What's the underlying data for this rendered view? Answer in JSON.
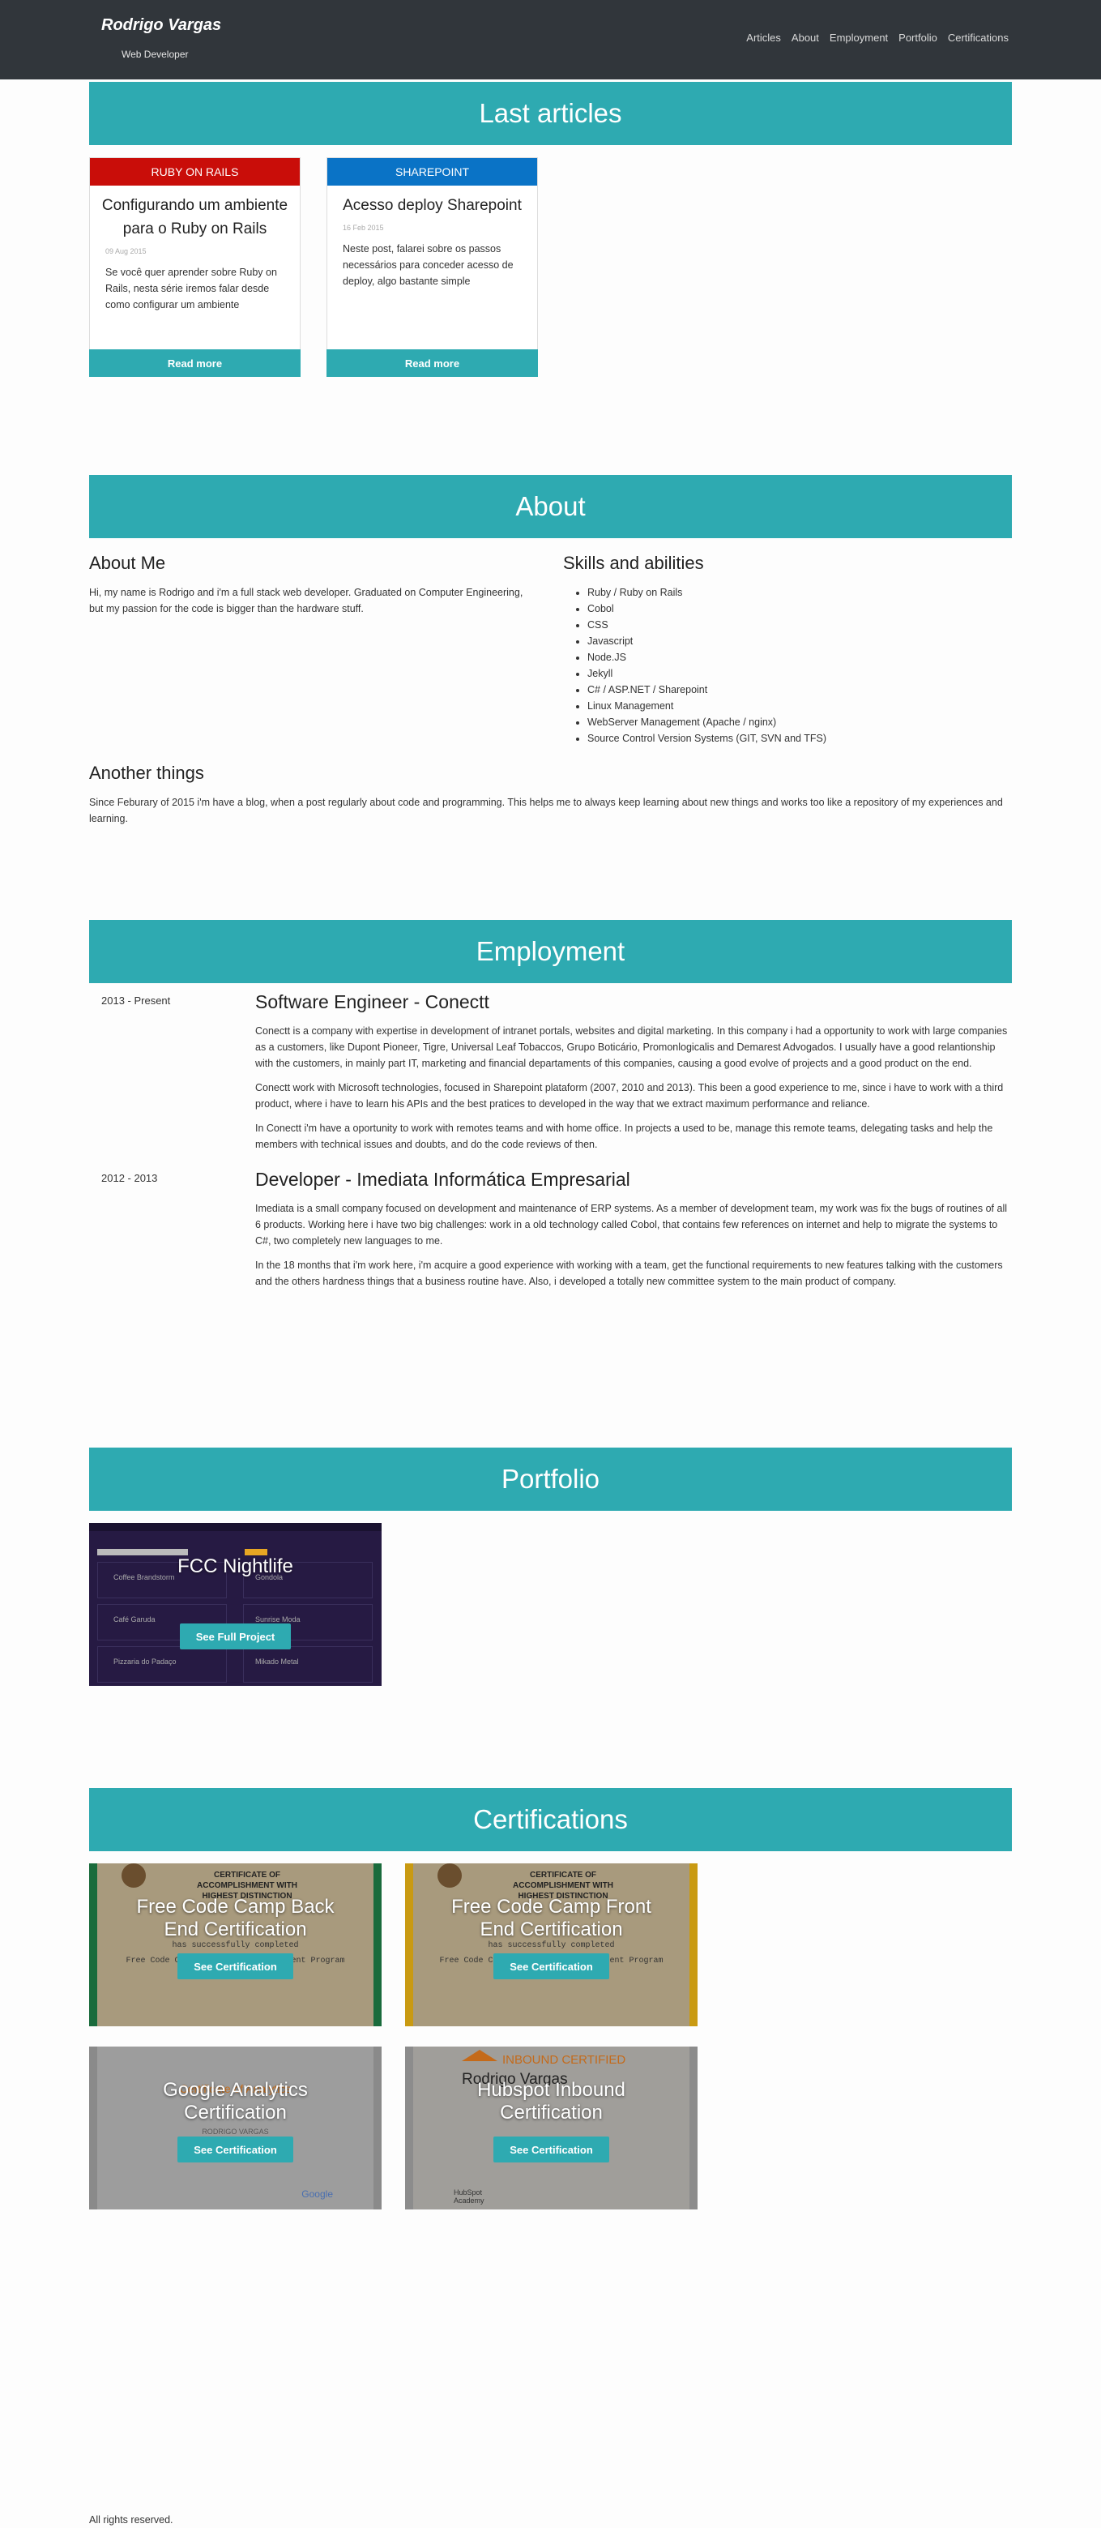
{
  "navbar": {
    "brand": "Rodrigo Vargas",
    "subtitle": "Web Developer",
    "links": [
      "Articles",
      "About",
      "Employment",
      "Portfolio",
      "Certifications"
    ]
  },
  "articles": {
    "heading": "Last articles",
    "items": [
      {
        "tag": "RUBY ON RAILS",
        "title": "Configurando um ambiente para o Ruby on Rails",
        "date": "09 Aug 2015",
        "excerpt": "Se você quer aprender sobre Ruby on Rails, nesta série iremos falar desde como configurar um ambiente",
        "cta": "Read more"
      },
      {
        "tag": "SHAREPOINT",
        "title": "Acesso deploy Sharepoint",
        "date": "16 Feb 2015",
        "excerpt": "Neste post, falarei sobre os passos necessários para conceder acesso de deploy, algo bastante simple",
        "cta": "Read more"
      }
    ]
  },
  "about": {
    "heading": "About",
    "me_title": "About Me",
    "me_text": "Hi, my name is Rodrigo and i'm a full stack web developer. Graduated on Computer Engineering, but my passion for the code is bigger than the hardware stuff.",
    "skills_title": "Skills and abilities",
    "skills": [
      "Ruby / Ruby on Rails",
      "Cobol",
      "CSS",
      "Javascript",
      "Node.JS",
      "Jekyll",
      "C# / ASP.NET / Sharepoint",
      "Linux Management",
      "WebServer Management (Apache / nginx)",
      "Source Control Version Systems (GIT, SVN and TFS)"
    ],
    "another_title": "Another things",
    "another_text": "Since Feburary of 2015 i'm have a blog, when a post regularly about code and programming. This helps me to always keep learning about new things and works too like a repository of my experiences and learning."
  },
  "employment": {
    "heading": "Employment",
    "jobs": [
      {
        "period": "2013 - Present",
        "title": "Software Engineer - Conectt",
        "paragraphs": [
          "Conectt is a company with expertise in development of intranet portals, websites and digital marketing. In this company i had a opportunity to work with large companies as a customers, like Dupont Pioneer, Tigre, Universal Leaf Tobaccos, Grupo Boticário, Promonlogicalis and Demarest Advogados. I usually have a good relantionship with the customers, in mainly part IT, marketing and financial departaments of this companies, causing a good evolve of projects and a good product on the end.",
          "Conectt work with Microsoft technologies, focused in Sharepoint plataform (2007, 2010 and 2013). This been a good experience to me, since i have to work with a third product, where i have to learn his APIs and the best pratices to developed in the way that we extract maximum performance and reliance.",
          "In Conectt i'm have a oportunity to work with remotes teams and with home office. In projects a used to be, manage this remote teams, delegating tasks and help the members with technical issues and doubts, and do the code reviews of then."
        ]
      },
      {
        "period": "2012 - 2013",
        "title": "Developer - Imediata Informática Empresarial",
        "paragraphs": [
          "Imediata is a small company focused on development and maintenance of ERP systems. As a member of development team, my work was fix the bugs of routines of all 6 products. Working here i have two big challenges: work in a old technology called Cobol, that contains few references on internet and help to migrate the systems to C#, two completely new languages to me.",
          "In the 18 months that i'm work here, i'm acquire a good experience with working with a team, get the functional requirements to new features talking with the customers and the others hardness things that a business routine have. Also, i developed a totally new committee system to the main product of company."
        ]
      }
    ]
  },
  "portfolio": {
    "heading": "Portfolio",
    "items": [
      {
        "title": "FCC Nightlife",
        "cta": "See Full Project",
        "thumb_labels": [
          "Coffee Brandstorm",
          "Gondola",
          "Café Garuda",
          "Sunrise Moda",
          "Pizzaria do Padaço",
          "Mikado Metal"
        ]
      }
    ]
  },
  "certifications": {
    "heading": "Certifications",
    "items": [
      {
        "title": "Free Code Camp Back End Certification",
        "cta": "See Certification",
        "paper_heading": "CERTIFICATE OF ACCOMPLISHMENT WITH HIGHEST DISTINCTION",
        "paper_line1": "has successfully completed",
        "paper_line2": "Free Code Camp's Back End Development Program",
        "color": "#1a6b3c"
      },
      {
        "title": "Free Code Camp Front End Certification",
        "cta": "See Certification",
        "paper_heading": "CERTIFICATE OF ACCOMPLISHMENT WITH HIGHEST DISTINCTION",
        "paper_line1": "has successfully completed",
        "paper_line2": "Free Code Camp's Front End Development Program",
        "color": "#c99a12"
      },
      {
        "title": "Google Analytics Certification",
        "cta": "See Certification",
        "paper_heading": "Certificate of Analytics",
        "paper_line1": "RODRIGO VARGAS",
        "paper_line2": "Google",
        "color": "#e8e8e8"
      },
      {
        "title": "Hubspot Inbound Certification",
        "cta": "See Certification",
        "paper_heading": "INBOUND CERTIFIED",
        "paper_line1": "Rodrigo Vargas",
        "paper_line2": "HubSpot Academy",
        "color": "#e8e8e8"
      }
    ]
  },
  "footer": {
    "text": "All rights reserved."
  }
}
